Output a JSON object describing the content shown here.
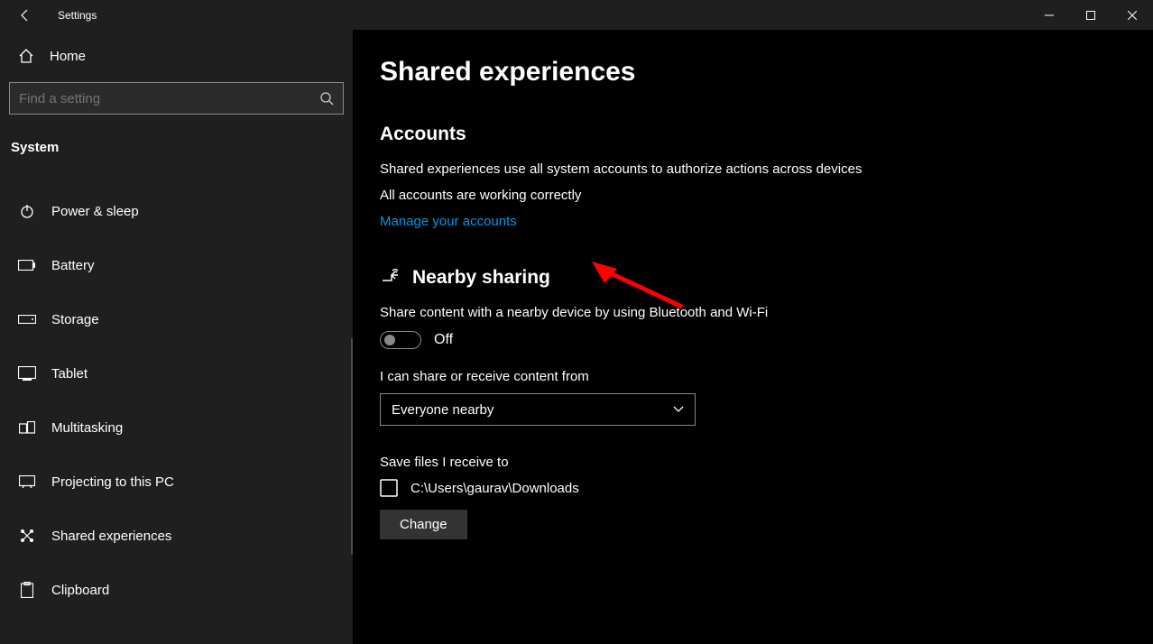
{
  "window": {
    "title": "Settings"
  },
  "sidebar": {
    "home": "Home",
    "search_placeholder": "Find a setting",
    "section": "System",
    "items": [
      {
        "label": "Power & sleep",
        "icon": "power-icon"
      },
      {
        "label": "Battery",
        "icon": "battery-icon"
      },
      {
        "label": "Storage",
        "icon": "storage-icon"
      },
      {
        "label": "Tablet",
        "icon": "tablet-icon"
      },
      {
        "label": "Multitasking",
        "icon": "multitasking-icon"
      },
      {
        "label": "Projecting to this PC",
        "icon": "projecting-icon"
      },
      {
        "label": "Shared experiences",
        "icon": "shared-experiences-icon"
      },
      {
        "label": "Clipboard",
        "icon": "clipboard-icon"
      }
    ]
  },
  "main": {
    "title": "Shared experiences",
    "accounts": {
      "heading": "Accounts",
      "description": "Shared experiences use all system accounts to authorize actions across devices",
      "status": "All accounts are working correctly",
      "manage_link": "Manage your accounts"
    },
    "nearby": {
      "heading": "Nearby sharing",
      "description": "Share content with a nearby device by using Bluetooth and Wi-Fi",
      "toggle_label": "Off",
      "share_from_label": "I can share or receive content from",
      "share_from_value": "Everyone nearby",
      "save_label": "Save files I receive to",
      "save_path": "C:\\Users\\gaurav\\Downloads",
      "change_button": "Change"
    }
  }
}
